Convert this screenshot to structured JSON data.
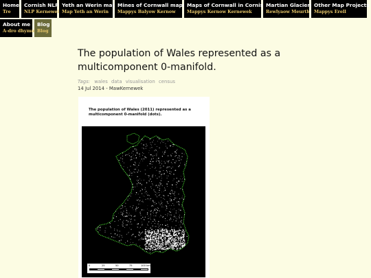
{
  "nav": {
    "items": [
      {
        "en": "Home",
        "kw": "Tre"
      },
      {
        "en": "Cornish NLP",
        "kw": "NLP Kernewek"
      },
      {
        "en": "Yeth an Werin map",
        "kw": "Map Yeth an Werin"
      },
      {
        "en": "Mines of Cornwall maps",
        "kw": "Mappys Balyow Kernow"
      },
      {
        "en": "Maps of Cornwall in Cornish",
        "kw": "Mappys Kernow Kernewek"
      },
      {
        "en": "Martian Glaciers",
        "kw": "Rewlyaow Meurth"
      },
      {
        "en": "Other Map Projects",
        "kw": "Mappys Erell"
      },
      {
        "en": "About me",
        "kw": "A-dro dhymm"
      },
      {
        "en": "Blog",
        "kw": "Blog"
      }
    ]
  },
  "post": {
    "title": "The population of Wales represented as a multicomponent 0-manifold.",
    "tags_label": "Tags:",
    "tags": [
      "wales",
      "data",
      "visualisation",
      "census"
    ],
    "meta": "14 Jul 2014 - MawKernewek"
  },
  "figure": {
    "title": "The population of Wales (2011) represented as a multicomponent 0-manifold (dots).",
    "scale_labels": [
      "0",
      "25",
      "50",
      "75",
      "100 km"
    ],
    "colors": {
      "background": "#000000",
      "coast": "#3fbf2a",
      "dots": "#ffffff"
    }
  }
}
